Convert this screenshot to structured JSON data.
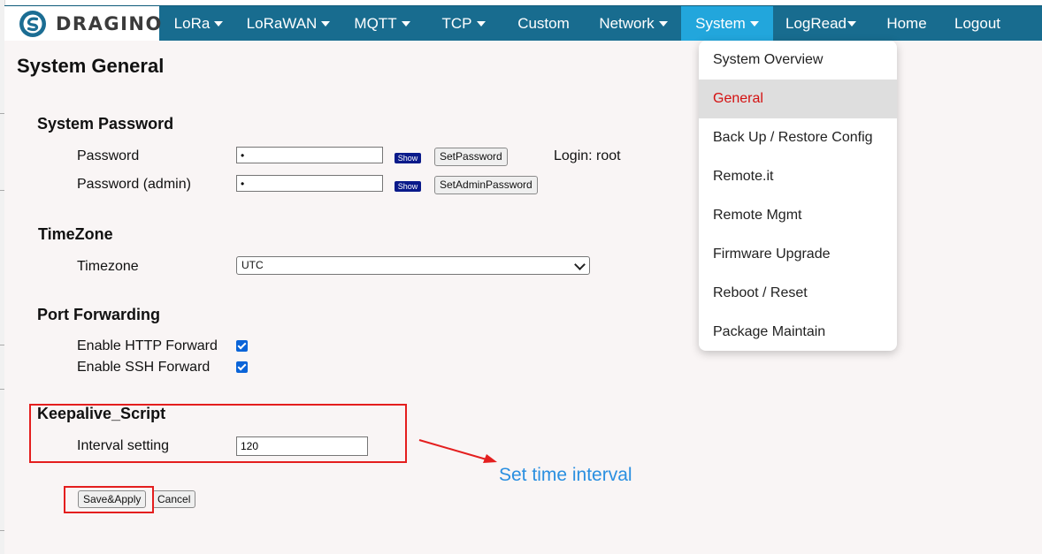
{
  "brand": {
    "logo_text": "DRAGINO"
  },
  "nav": {
    "items": [
      {
        "label": "LoRa",
        "has_caret": true
      },
      {
        "label": "LoRaWAN",
        "has_caret": true
      },
      {
        "label": "MQTT",
        "has_caret": true
      },
      {
        "label": "TCP",
        "has_caret": true
      },
      {
        "label": "Custom",
        "has_caret": false
      },
      {
        "label": "Network",
        "has_caret": true
      },
      {
        "label": "System",
        "has_caret": true,
        "active": true
      },
      {
        "label": "LogRead",
        "has_caret": true
      },
      {
        "label": "Home",
        "has_caret": false
      },
      {
        "label": "Logout",
        "has_caret": false
      }
    ]
  },
  "page": {
    "title": "System General"
  },
  "system_password": {
    "title": "System Password",
    "password_label": "Password",
    "password_value": "•",
    "show_label": "Show",
    "set_password_label": "SetPassword",
    "login_text": "Login: root",
    "admin_password_label": "Password (admin)",
    "admin_password_value": "•",
    "set_admin_password_label": "SetAdminPassword"
  },
  "timezone": {
    "title": "TimeZone",
    "label": "Timezone",
    "selected": "UTC"
  },
  "port_forwarding": {
    "title": "Port Forwarding",
    "http_label": "Enable HTTP Forward",
    "http_checked": true,
    "ssh_label": "Enable SSH Forward",
    "ssh_checked": true
  },
  "keepalive": {
    "title": "Keepalive_Script",
    "interval_label": "Interval setting",
    "interval_value": "120"
  },
  "actions": {
    "save_label": "Save&Apply",
    "cancel_label": "Cancel"
  },
  "system_menu": {
    "items": [
      {
        "label": "System Overview"
      },
      {
        "label": "General",
        "active": true
      },
      {
        "label": "Back Up / Restore Config"
      },
      {
        "label": "Remote.it"
      },
      {
        "label": "Remote Mgmt"
      },
      {
        "label": "Firmware Upgrade"
      },
      {
        "label": "Reboot / Reset"
      },
      {
        "label": "Package Maintain"
      }
    ]
  },
  "annotation": {
    "text": "Set time interval",
    "color": "#2a8fe0",
    "box_color": "#e41e1e"
  },
  "colors": {
    "nav_bg": "#186c8f",
    "nav_active": "#22a6dc",
    "menu_active_text": "#d41010"
  }
}
